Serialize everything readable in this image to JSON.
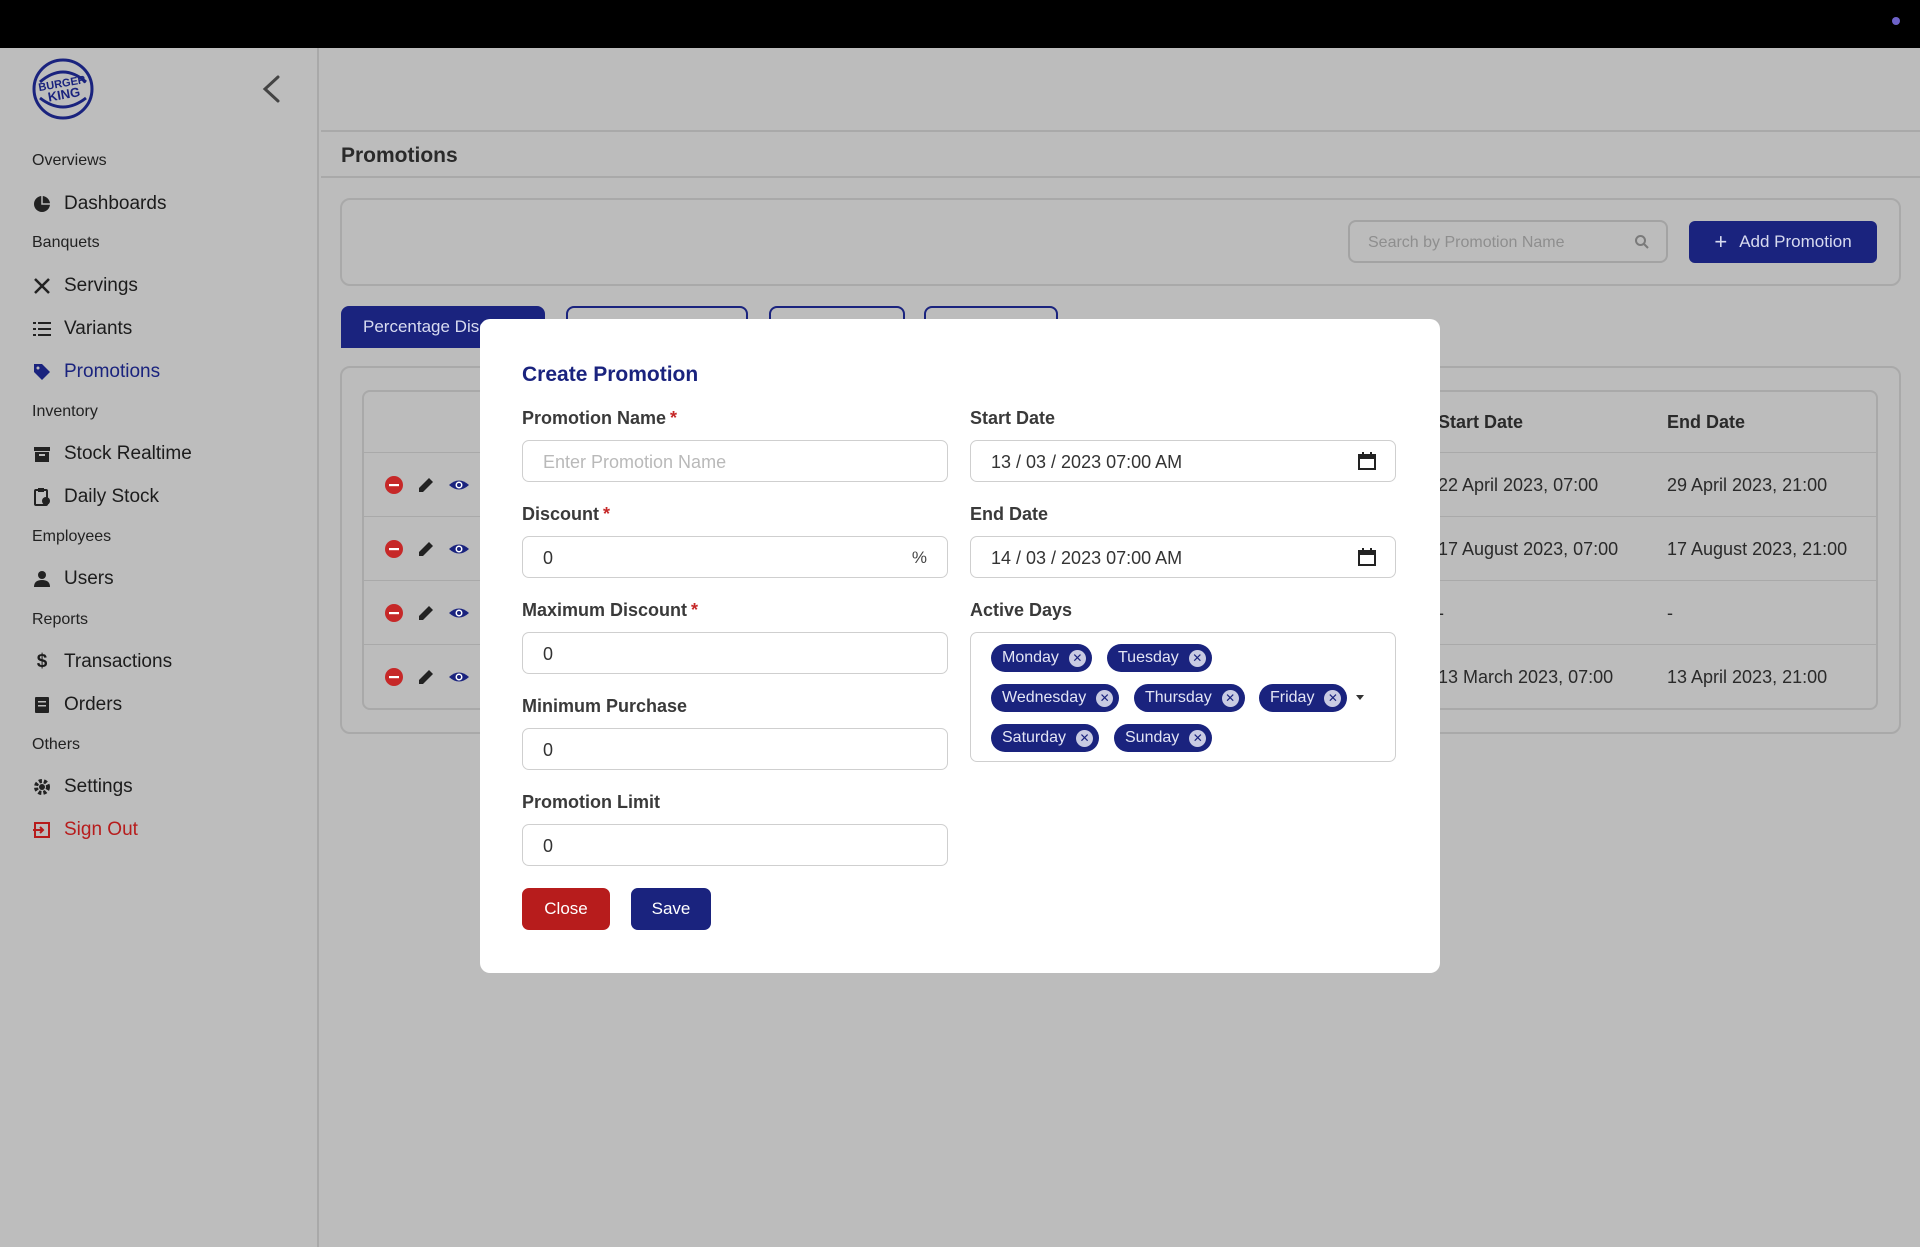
{
  "sidebar": {
    "sections": {
      "overviews": "Overviews",
      "banquets": "Banquets",
      "inventory": "Inventory",
      "employees": "Employees",
      "reports": "Reports",
      "others": "Others"
    },
    "items": {
      "dashboards": "Dashboards",
      "servings": "Servings",
      "variants": "Variants",
      "promotions": "Promotions",
      "stock_realtime": "Stock Realtime",
      "daily_stock": "Daily Stock",
      "users": "Users",
      "transactions": "Transactions",
      "orders": "Orders",
      "settings": "Settings",
      "sign_out": "Sign Out"
    }
  },
  "page": {
    "title": "Promotions",
    "search_placeholder": "Search by Promotion Name",
    "add_button": "Add Promotion",
    "tabs": [
      "Percentage Discount",
      "",
      "",
      ""
    ]
  },
  "table": {
    "headers": {
      "start_date": "Start Date",
      "end_date": "End Date"
    },
    "rows": [
      {
        "start": "22 April 2023, 07:00",
        "end": "29 April 2023, 21:00"
      },
      {
        "start": "17 August 2023, 07:00",
        "end": "17 August 2023, 21:00"
      },
      {
        "start": "-",
        "end": "-"
      },
      {
        "start": "13 March 2023, 07:00",
        "end": "13 April 2023, 21:00"
      }
    ]
  },
  "modal": {
    "title": "Create Promotion",
    "promotion_name": {
      "label": "Promotion Name",
      "placeholder": "Enter Promotion Name"
    },
    "discount": {
      "label": "Discount",
      "value": "0",
      "suffix": "%"
    },
    "maximum_discount": {
      "label": "Maximum Discount",
      "value": "0"
    },
    "minimum_purchase": {
      "label": "Minimum Purchase",
      "value": "0"
    },
    "promotion_limit": {
      "label": "Promotion Limit",
      "value": "0"
    },
    "start_date": {
      "label": "Start Date",
      "value": "13 / 03 / 2023 07:00 AM"
    },
    "end_date": {
      "label": "End Date",
      "value": "14 / 03 / 2023 07:00 AM"
    },
    "active_days": {
      "label": "Active Days",
      "chips": [
        "Monday",
        "Tuesday",
        "Wednesday",
        "Thursday",
        "Friday",
        "Saturday",
        "Sunday"
      ]
    },
    "required_mark": "*",
    "close_button": "Close",
    "save_button": "Save"
  },
  "colors": {
    "primary": "#1a237e",
    "danger": "#b71c1c",
    "backdrop": "#bcbcbc"
  }
}
